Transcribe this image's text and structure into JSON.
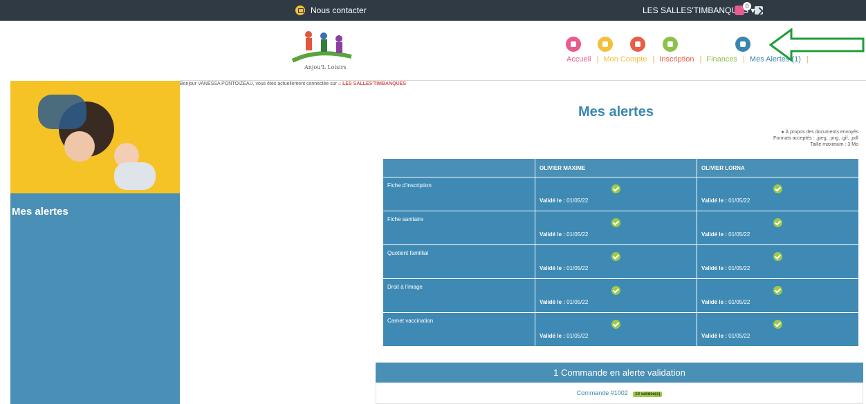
{
  "topbar": {
    "contact_label": "Nous contacter",
    "site_menu_label": "LES SALLES'TIMBANQUES ▾",
    "cart_count": "0"
  },
  "nav": {
    "items": [
      {
        "label": "Accueil",
        "color": "#e85b8f"
      },
      {
        "label": "Mon Compte",
        "color": "#f4bf3b"
      },
      {
        "label": "Inscription",
        "color": "#ea5c45"
      },
      {
        "label": "Finances",
        "color": "#8ec14c"
      },
      {
        "label": "Mes Alertes (1)",
        "color": "#3a86b0"
      }
    ]
  },
  "greeting": {
    "text": "Bonjour VANESSA PONTOIZEAU, vous êtes actuellement connectée sur",
    "place": "LES SALLES'TIMBANQUES"
  },
  "sidebar": {
    "title": "Mes alertes"
  },
  "main": {
    "title": "Mes alertes",
    "doc_info": [
      "À propos des documents envoyés",
      "Formats acceptés : .jpeg, .png, .gif, .pdf",
      "Taille maximum : 3 Mo"
    ]
  },
  "table": {
    "headers": [
      "",
      "OLIVIER MAXIME",
      "OLIVIER LORNA"
    ],
    "valid_label": "Validé le :",
    "rows": [
      {
        "doc": "Fiche d'inscription",
        "date1": "01/05/22",
        "date2": "01/05/22"
      },
      {
        "doc": "Fiche sanitaire",
        "date1": "01/05/22",
        "date2": "01/05/22"
      },
      {
        "doc": "Quotient famillial",
        "date1": "01/05/22",
        "date2": "01/05/22"
      },
      {
        "doc": "Droit à l'image",
        "date1": "01/05/22",
        "date2": "01/05/22"
      },
      {
        "doc": "Carnet vaccination",
        "date1": "01/05/22",
        "date2": "01/05/22"
      }
    ]
  },
  "orders": {
    "header": "1 Commande en alerte validation",
    "order_link": "Commande #1002",
    "order_badge": "10 validée(s)"
  },
  "logo": {
    "text": "Anjou'L Loisirs"
  }
}
